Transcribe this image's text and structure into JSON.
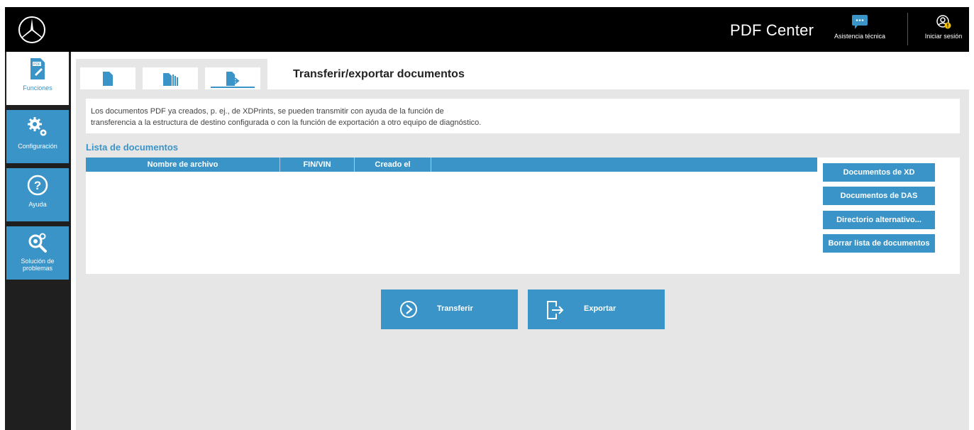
{
  "header": {
    "app_title": "PDF Center",
    "support_label": "Asistencia técnica",
    "login_label": "Iniciar sesión"
  },
  "sidebar": {
    "items": [
      {
        "label": "Funciones",
        "icon": "pdf-document-icon",
        "active": true
      },
      {
        "label": "Configuración",
        "icon": "gears-icon",
        "active": false
      },
      {
        "label": "Ayuda",
        "icon": "help-icon",
        "active": false
      },
      {
        "label": "Solución de problemas",
        "icon": "troubleshoot-icon",
        "active": false
      }
    ]
  },
  "main": {
    "tabs": [
      {
        "icon": "document-icon"
      },
      {
        "icon": "documents-stack-icon"
      },
      {
        "icon": "document-export-icon",
        "active": true
      }
    ],
    "section_title": "Transferir/exportar documentos",
    "description_line1": "Los documentos PDF ya creados, p. ej., de XDPrints, se pueden transmitir con ayuda de la función de",
    "description_line2": "transferencia a la estructura de destino configurada o con la función de exportación a otro equipo de diagnóstico.",
    "list_title": "Lista de documentos",
    "table": {
      "columns": [
        "Nombre de archivo",
        "FIN/VIN",
        "Creado el"
      ],
      "rows": []
    },
    "side_buttons": [
      "Documentos de XD",
      "Documentos de DAS",
      "Directorio alternativo...",
      "Borrar lista de documentos"
    ],
    "transfer_label": "Transferir",
    "export_label": "Exportar"
  },
  "colors": {
    "accent": "#3a94c8",
    "topbar": "#000000",
    "sidebar": "#1f1f1f",
    "background": "#e6e6e6"
  }
}
